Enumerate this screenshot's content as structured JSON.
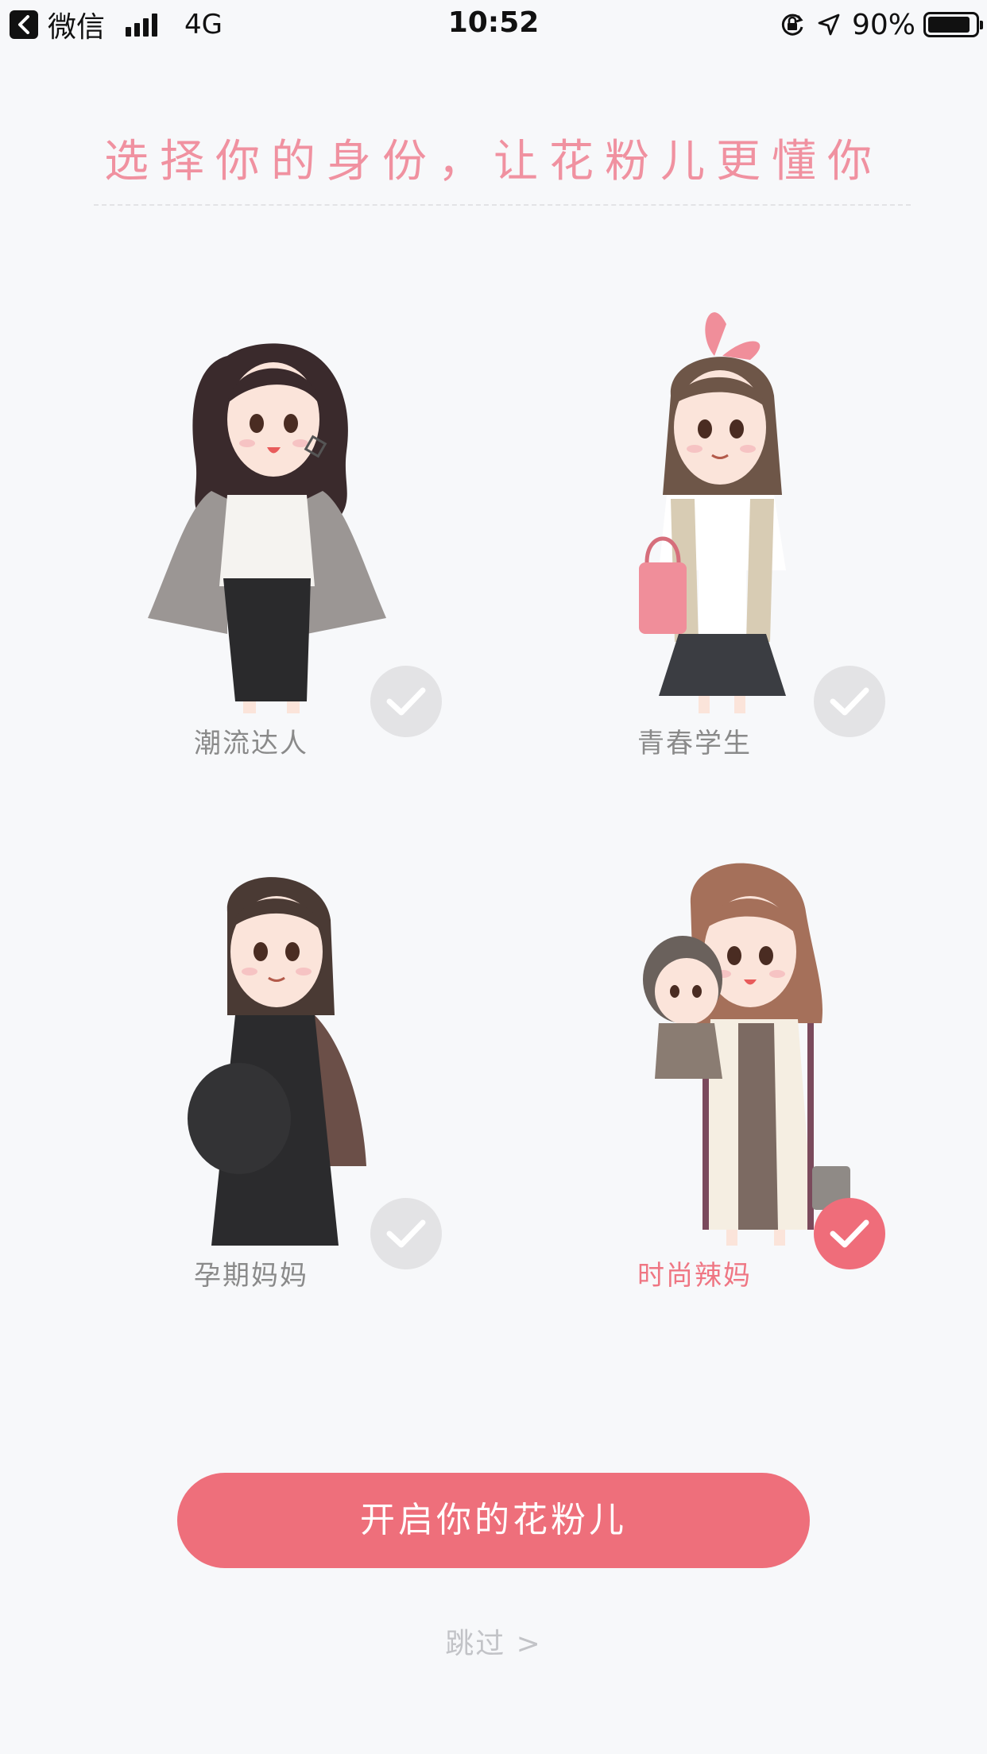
{
  "status_bar": {
    "back_app": "微信",
    "network": "4G",
    "time": "10:52",
    "battery_percent": "90%",
    "battery_level": 0.9,
    "icons": [
      "back-icon",
      "signal-icon",
      "rotation-lock-icon",
      "location-arrow-icon",
      "battery-icon"
    ]
  },
  "header": {
    "title": "选择你的身份，让花粉儿更懂你"
  },
  "identities": [
    {
      "label": "潮流达人",
      "selected": false,
      "icon": "check-icon"
    },
    {
      "label": "青春学生",
      "selected": false,
      "icon": "check-icon"
    },
    {
      "label": "孕期妈妈",
      "selected": false,
      "icon": "check-icon"
    },
    {
      "label": "时尚辣妈",
      "selected": true,
      "icon": "check-icon"
    }
  ],
  "actions": {
    "start_label": "开启你的花粉儿",
    "skip_label": "跳过 >"
  },
  "colors": {
    "accent": "#ee6f7b",
    "title": "#f091a0",
    "unselected_check": "#e3e3e5",
    "label": "#8a8a8a",
    "background": "#f7f8fa"
  }
}
